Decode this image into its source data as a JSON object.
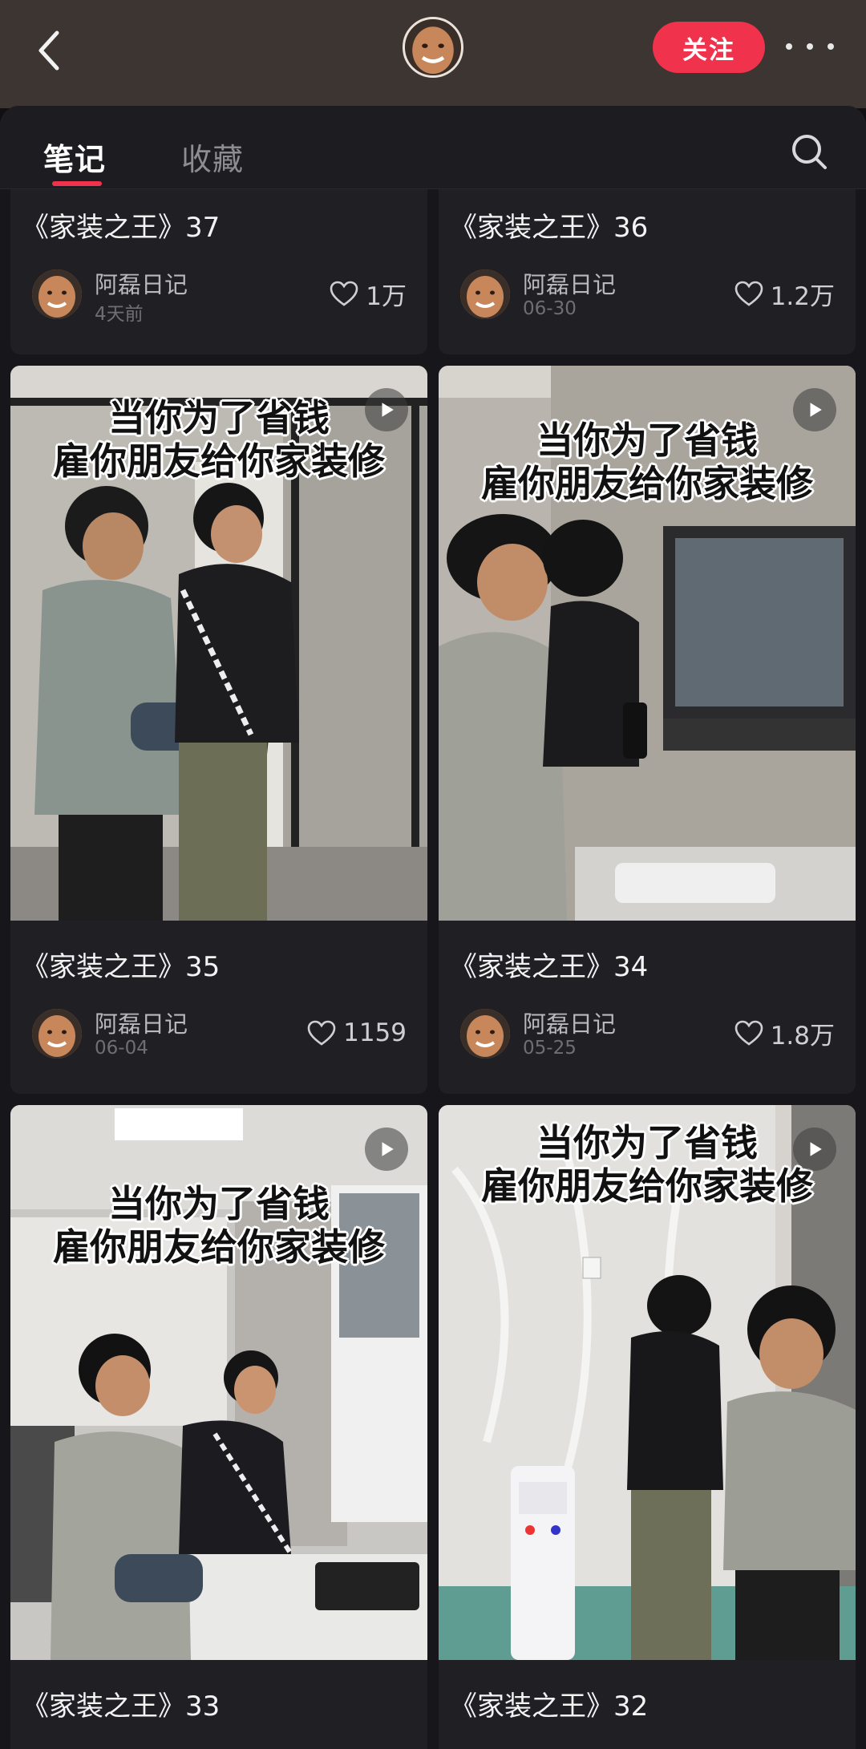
{
  "header": {
    "back_icon": "chevron-left-icon",
    "follow_label": "关注",
    "more_icon": "more-dots-icon",
    "accent_color": "#f1324c"
  },
  "tabs": [
    {
      "label": "笔记",
      "active": true
    },
    {
      "label": "收藏",
      "active": false
    }
  ],
  "search_icon": "search-icon",
  "notes": [
    {
      "title": "《家装之王》37",
      "author": "阿磊日记",
      "date": "4天前",
      "likes": "1万",
      "has_cover": false
    },
    {
      "title": "《家装之王》36",
      "author": "阿磊日记",
      "date": "06-30",
      "likes": "1.2万",
      "has_cover": false
    },
    {
      "title": "《家装之王》35",
      "author": "阿磊日记",
      "date": "06-04",
      "likes": "1159",
      "has_cover": true,
      "cover_caption": [
        "当你为了省钱",
        "雇你朋友给你家装修"
      ],
      "is_video": true
    },
    {
      "title": "《家装之王》34",
      "author": "阿磊日记",
      "date": "05-25",
      "likes": "1.8万",
      "has_cover": true,
      "cover_caption": [
        "当你为了省钱",
        "雇你朋友给你家装修"
      ],
      "is_video": true
    },
    {
      "title": "《家装之王》33",
      "author": "",
      "date": "",
      "likes": "",
      "has_cover": true,
      "cover_caption": [
        "当你为了省钱",
        "雇你朋友给你家装修"
      ],
      "is_video": true
    },
    {
      "title": "《家装之王》32",
      "author": "",
      "date": "",
      "likes": "",
      "has_cover": true,
      "cover_caption": [
        "当你为了省钱",
        "雇你朋友给你家装修"
      ],
      "is_video": true
    }
  ]
}
